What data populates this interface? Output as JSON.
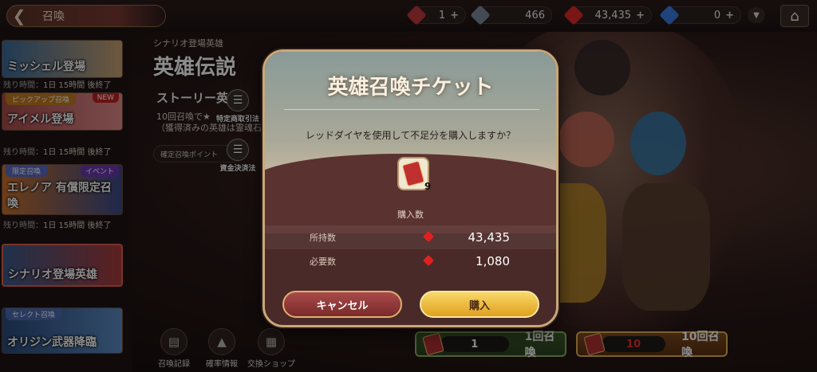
{
  "topbar": {
    "title": "召喚",
    "resources": [
      {
        "name": "ticket",
        "value": "1",
        "color": "#c03a3a"
      },
      {
        "name": "silver-cube",
        "value": "466",
        "color": "#7a8a9a"
      },
      {
        "name": "red-diamond",
        "value": "43,435",
        "color": "#e02828"
      },
      {
        "name": "blue-diamond",
        "value": "0",
        "color": "#3a7ae0"
      }
    ]
  },
  "sidebar": {
    "banners": [
      {
        "label": "ミッシェル登場",
        "tag": "",
        "tag2": "",
        "timer_key": "残り時間：",
        "timer_val": "1日 15時間 後終了"
      },
      {
        "label": "アイメル登場",
        "tag": "ピックアップ召喚",
        "tag2": "NEW",
        "timer_key": "残り時間：",
        "timer_val": "1日 15時間 後終了"
      },
      {
        "label": "エレノア 有償限定召喚",
        "tag": "限定召喚",
        "tag2": "イベント",
        "timer_key": "残り時間：",
        "timer_val": "1日 15時間 後終了"
      },
      {
        "label": "シナリオ登場英雄",
        "tag": "",
        "tag2": "",
        "timer_key": "",
        "timer_val": ""
      },
      {
        "label": "オリジン武器降臨",
        "tag": "セレクト召喚",
        "tag2": "",
        "timer_key": "",
        "timer_val": ""
      }
    ]
  },
  "main": {
    "subtitle": "シナリオ登場英雄",
    "heading": "英雄伝説",
    "story": "ストーリー英",
    "desc_line1": "10回召喚で★",
    "desc_line2": "（獲得済みの英雄は霊魂石",
    "kakutei": "確定召喚ポイント",
    "doc1": "特定商取引法",
    "doc2": "資金決済法"
  },
  "bottom": {
    "icons": [
      "召喚記録",
      "確率情報",
      "交換ショップ"
    ],
    "summon1_count": "1",
    "summon1_label": "1回召喚",
    "summon10_count": "10",
    "summon10_label": "10回召喚"
  },
  "dialog": {
    "title": "英雄召喚チケット",
    "message": "レッドダイヤを使用して不足分を購入しますか？",
    "ticket_count": "9",
    "buy_amount_label": "購入数",
    "owned_label": "所持数",
    "owned_value": "43,435",
    "required_label": "必要数",
    "required_value": "1,080",
    "cancel": "キャンセル",
    "buy": "購入"
  }
}
